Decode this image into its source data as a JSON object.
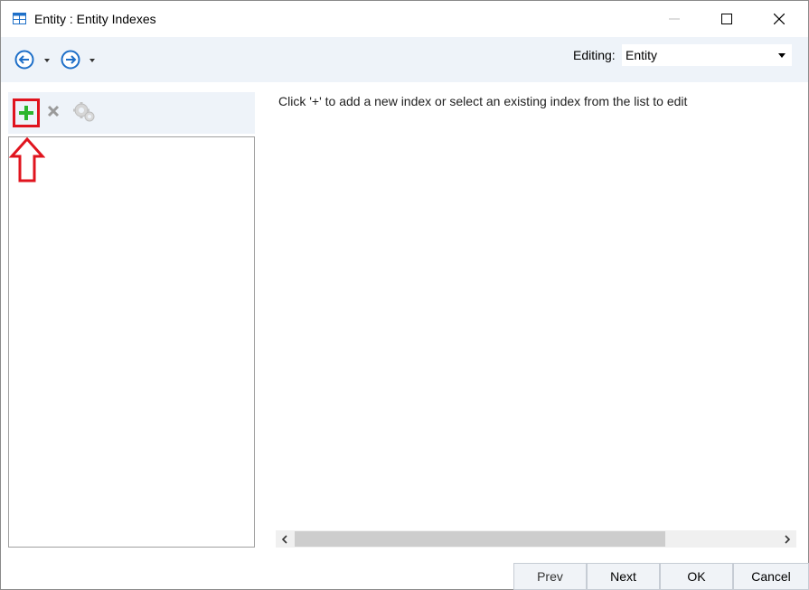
{
  "window": {
    "title": "Entity : Entity Indexes",
    "icon": "table-icon"
  },
  "toolbar": {
    "back_icon": "arrow-left-circle-icon",
    "forward_icon": "arrow-right-circle-icon",
    "editing_label": "Editing:",
    "editing_value": "Entity"
  },
  "left_panel": {
    "add_icon": "plus-icon",
    "delete_icon": "x-icon",
    "settings_icon": "gear-icon",
    "items": []
  },
  "right_panel": {
    "hint": "Click '+' to add a new index or select an existing index from the list to edit"
  },
  "buttons": {
    "prev": "Prev",
    "next": "Next",
    "ok": "OK",
    "cancel": "Cancel"
  },
  "colors": {
    "accent_blue": "#1e6fc8",
    "add_green": "#2cb52c",
    "highlight_red": "#e0141e",
    "toolbar_bg": "#eef3f9"
  }
}
